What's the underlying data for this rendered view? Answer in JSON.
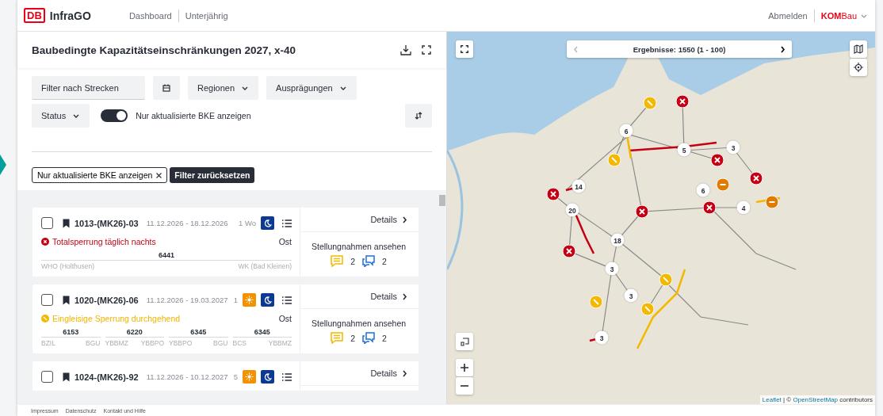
{
  "header": {
    "logo": "DB",
    "brand": "InfraGO",
    "nav": [
      {
        "label": "Dashboard",
        "selected": false
      },
      {
        "label": "Unterjährig",
        "selected": false
      }
    ],
    "logout": "Abmelden",
    "product": "**KOM**Bau"
  },
  "panel": {
    "title": "Baubedingte Kapazitätseinschränkungen 2027, x-40"
  },
  "filters": {
    "controls": [
      {
        "kind": "field",
        "label": "Filter nach Strecken"
      },
      {
        "kind": "calendar"
      },
      {
        "kind": "dropdown",
        "label": "Regionen"
      },
      {
        "kind": "dropdown",
        "label": "Ausprägungen"
      }
    ],
    "status": {
      "label": "Status"
    },
    "toggle": {
      "label": "Nur aktualisierte BKE anzeigen",
      "on": true
    },
    "chips": [
      {
        "label": "Nur aktualisierte BKE anzeigen"
      }
    ],
    "reset": "Filter zurücksetzen"
  },
  "cards": [
    {
      "id": "1013-(MK26)-03",
      "dates": "11.12.2026 - 18.12.2026",
      "duration": "1 Wo",
      "selected": false,
      "day": false,
      "night": true,
      "status": {
        "kind": "closure",
        "label": "Totalsperrung täglich nachts"
      },
      "region": "Ost",
      "segments": [
        {
          "line": "6441",
          "from": "WHO (Holthusen)",
          "to": "WK (Bad Kleinen)"
        }
      ],
      "details": "Details",
      "statements": "Stellungnahmen ansehen",
      "comments": "2",
      "replies": "2"
    },
    {
      "id": "1020-(MK26)-06",
      "dates": "11.12.2026 - 19.03.2027",
      "duration": "1",
      "selected": false,
      "day": true,
      "night": true,
      "status": {
        "kind": "single",
        "label": "Eingleisige Sperrung durchgehend"
      },
      "region": "Ost",
      "segments": [
        {
          "line": "6153",
          "from": "BZIL",
          "to": "BGU"
        },
        {
          "line": "6220",
          "from": "YBBMZ",
          "to": "YBBPO"
        },
        {
          "line": "6345",
          "from": "YBBPO",
          "to": "BGU"
        },
        {
          "line": "6345",
          "from": "BCS",
          "to": "YBBMZ"
        }
      ],
      "details": "Details",
      "statements": "Stellungnahmen ansehen",
      "comments": "2",
      "replies": "2"
    },
    {
      "id": "1024-(MK26)-92",
      "dates": "11.12.2026 - 10.12.2027",
      "duration": "5",
      "selected": false,
      "day": true,
      "night": true,
      "details": "Details"
    }
  ],
  "map": {
    "results": "Ergebnisse: 1550 (1 - 100)",
    "prev_disabled": true,
    "markers": [
      {
        "kind": "single"
      },
      {
        "kind": "closure"
      },
      {
        "kind": "cluster",
        "count": "6"
      },
      {
        "kind": "cluster",
        "count": "5"
      },
      {
        "kind": "cluster",
        "count": "3"
      },
      {
        "kind": "single"
      },
      {
        "kind": "closure"
      },
      {
        "kind": "closure"
      },
      {
        "kind": "closure"
      },
      {
        "kind": "cluster",
        "count": "14"
      },
      {
        "kind": "partial"
      },
      {
        "kind": "cluster",
        "count": "6"
      },
      {
        "kind": "partial"
      },
      {
        "kind": "cluster",
        "count": "20"
      },
      {
        "kind": "closure"
      },
      {
        "kind": "closure"
      },
      {
        "kind": "cluster",
        "count": "4"
      },
      {
        "kind": "cluster",
        "count": "18"
      },
      {
        "kind": "closure"
      },
      {
        "kind": "cluster",
        "count": "3"
      },
      {
        "kind": "single"
      },
      {
        "kind": "cluster",
        "count": "3"
      },
      {
        "kind": "single"
      },
      {
        "kind": "single"
      },
      {
        "kind": "cluster",
        "count": "3"
      }
    ],
    "attribution": {
      "leaflet": "Leaflet",
      "separator": "| ©",
      "osm": "OpenStreetMap",
      "suffix": "contributors"
    }
  },
  "footer": [
    "Impressum",
    "Datenschutz",
    "Kontakt und Hilfe"
  ]
}
